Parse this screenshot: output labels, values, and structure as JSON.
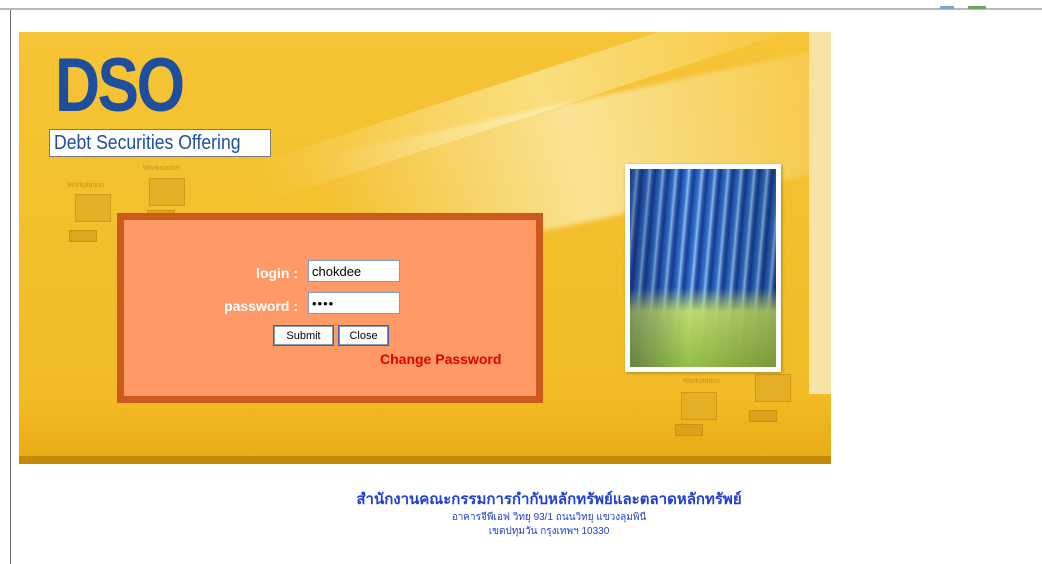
{
  "banner": {
    "logo_text": "DSO",
    "subtitle": "Debt Securities Offering",
    "workstation_label": "Workstation"
  },
  "login_form": {
    "login_label": "login :",
    "login_value": "chokdee",
    "password_label": "password :",
    "password_value": "••••",
    "submit_label": "Submit",
    "close_label": "Close",
    "change_password_label": "Change Password"
  },
  "footer": {
    "organization": "สำนักงานคณะกรรมการกำกับหลักทรัพย์และตลาดหลักทรัพย์",
    "address_line1": "อาคารจีพีเอฟ วิทยุ 93/1 ถนนวิทยุ แขวงลุมพินี",
    "address_line2": "เขตปทุมวัน กรุงเทพฯ 10330"
  },
  "colors": {
    "logo_blue": "#1d4f9e",
    "panel_fill": "#ff9a66",
    "panel_border": "#cc5a1c",
    "banner_yellow": "#f4c02e",
    "link_red": "#e00000",
    "footer_blue": "#1f3fd6"
  }
}
